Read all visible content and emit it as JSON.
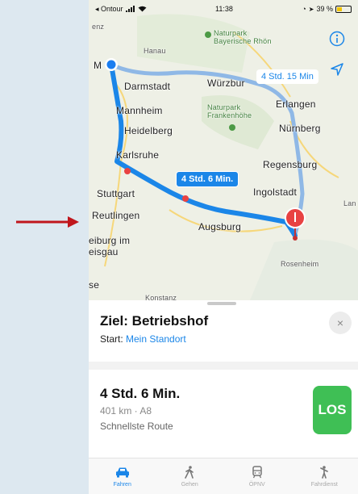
{
  "status_bar": {
    "carrier": "◂ Ontour",
    "time": "11:38",
    "battery": "39 %",
    "battery_level": 0.39
  },
  "map": {
    "cities": [
      {
        "name": "enz",
        "cls": "small"
      },
      {
        "name": "Hanau",
        "cls": "small"
      },
      {
        "name": "Naturpark\nBayerische Rhön",
        "cls": "green"
      },
      {
        "name": "M",
        "cls": ""
      },
      {
        "name": "Darmstadt",
        "cls": ""
      },
      {
        "name": "Würzbur",
        "cls": ""
      },
      {
        "name": "Erlangen",
        "cls": ""
      },
      {
        "name": "Mannheim",
        "cls": ""
      },
      {
        "name": "Naturpark\nFrankenhöhe",
        "cls": "green"
      },
      {
        "name": "Heidelberg",
        "cls": ""
      },
      {
        "name": "Nürnberg",
        "cls": ""
      },
      {
        "name": "Karlsruhe",
        "cls": ""
      },
      {
        "name": "Regensburg",
        "cls": ""
      },
      {
        "name": "Stuttgart",
        "cls": ""
      },
      {
        "name": "Ingolstadt",
        "cls": ""
      },
      {
        "name": "Lan",
        "cls": "small"
      },
      {
        "name": "Reutlingen",
        "cls": ""
      },
      {
        "name": "Augsburg",
        "cls": ""
      },
      {
        "name": "eiburg im\neisgau",
        "cls": ""
      },
      {
        "name": "Rosenheim",
        "cls": "small"
      },
      {
        "name": "se",
        "cls": ""
      },
      {
        "name": "Konstanz",
        "cls": "small"
      }
    ],
    "primary_route_label": "4 Std. 6 Min.",
    "alt_route_label": "4 Std. 15 Min",
    "info_icon": "info-icon",
    "locate_icon": "location-arrow-icon"
  },
  "sheet": {
    "destination": "Ziel: Betriebshof",
    "start_prefix": "Start: ",
    "start_location": "Mein Standort",
    "close_label": "×",
    "route_time": "4 Std. 6 Min.",
    "route_distance": "401 km · A8",
    "route_description": "Schnellste Route",
    "go_label": "LOS"
  },
  "tabs": [
    {
      "label": "Fahren",
      "icon": "car-icon",
      "active": true
    },
    {
      "label": "Gehen",
      "icon": "walk-icon",
      "active": false
    },
    {
      "label": "ÖPNV",
      "icon": "transit-icon",
      "active": false
    },
    {
      "label": "Fahrdienst",
      "icon": "rideshare-icon",
      "active": false
    }
  ],
  "colors": {
    "accent": "#1b86e8",
    "go": "#3fbf55",
    "pin": "#e84242",
    "arrow": "#c0161c"
  }
}
